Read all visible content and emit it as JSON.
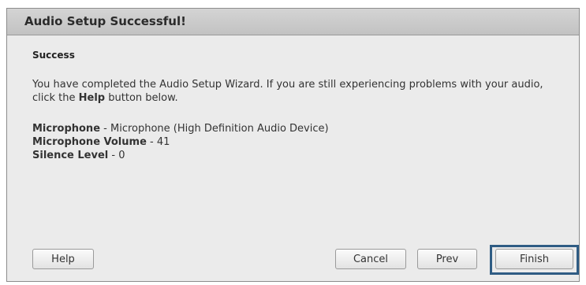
{
  "dialog": {
    "title": "Audio Setup Successful!",
    "heading": "Success",
    "message": {
      "part1": "You have completed the Audio Setup Wizard. If you are still experiencing problems with your audio, click the ",
      "bold": "Help",
      "part2": " button below."
    },
    "microphone": {
      "label": "Microphone",
      "sep": " - ",
      "value": "Microphone (High Definition Audio Device)"
    },
    "volume": {
      "label": "Microphone Volume",
      "sep": " - ",
      "value": "41"
    },
    "silence": {
      "label": "Silence Level",
      "sep": " - ",
      "value": "0"
    }
  },
  "buttons": {
    "help": "Help",
    "cancel": "Cancel",
    "prev": "Prev",
    "finish": "Finish"
  }
}
